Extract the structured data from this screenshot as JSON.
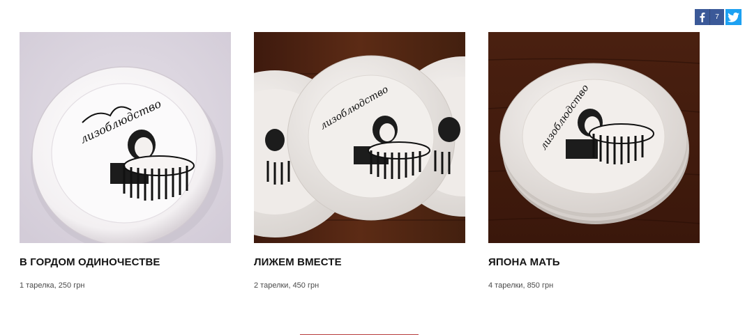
{
  "share": {
    "facebook_icon": "facebook-icon",
    "facebook_count": "7",
    "twitter_icon": "twitter-icon",
    "colors": {
      "facebook": "#3b5998",
      "twitter": "#1da1f2"
    }
  },
  "products": [
    {
      "title": "В ГОРДОМ ОДИНОЧЕСТВЕ",
      "subtitle": "1 тарелка, 250 грн",
      "plate_logo": "лизоблюдство"
    },
    {
      "title": "ЛИЖЕМ ВМЕСТЕ",
      "subtitle": "2 тарелки, 450 грн",
      "plate_logo": "лизоблюдство"
    },
    {
      "title": "ЯПОНА МАТЬ",
      "subtitle": "4 тарелки, 850 грн",
      "plate_logo": "лизоблюдство"
    }
  ],
  "colors": {
    "divider": "#b73b3b",
    "wood": "#5a2a16",
    "lilac": "#d8d2dc"
  }
}
